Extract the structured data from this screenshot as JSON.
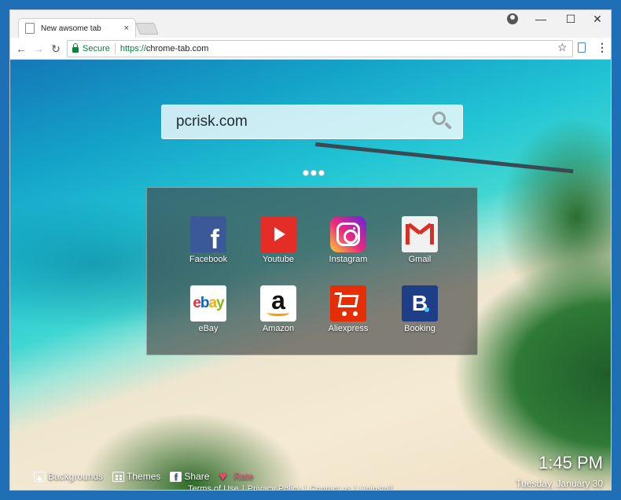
{
  "browser": {
    "tab_title": "New awsome tab",
    "tab_close": "×",
    "window_controls": {
      "minimize": "—",
      "maximize": "☐",
      "close": "✕"
    },
    "nav": {
      "back": "←",
      "forward": "→",
      "reload": "↻"
    },
    "address": {
      "secure_label": "Secure",
      "scheme": "https://",
      "host": "chrome-tab.com"
    },
    "star": "☆",
    "menu": "⋮"
  },
  "search": {
    "value": "pcrisk.com",
    "icon": "search-icon"
  },
  "tiles": [
    {
      "label": "Facebook",
      "icon": "facebook-icon"
    },
    {
      "label": "Youtube",
      "icon": "youtube-icon"
    },
    {
      "label": "Instagram",
      "icon": "instagram-icon"
    },
    {
      "label": "Gmail",
      "icon": "gmail-icon"
    },
    {
      "label": "eBay",
      "icon": "ebay-icon"
    },
    {
      "label": "Amazon",
      "icon": "amazon-icon"
    },
    {
      "label": "Aliexpress",
      "icon": "aliexpress-icon"
    },
    {
      "label": "Booking",
      "icon": "booking-icon"
    }
  ],
  "icon_glyphs": {
    "facebook": "f",
    "amazon": "a",
    "booking": "B"
  },
  "footer": {
    "links": [
      {
        "label": "Backgrounds",
        "icon": "image-icon"
      },
      {
        "label": "Themes",
        "icon": "themes-icon"
      },
      {
        "label": "Share",
        "icon": "facebook-icon"
      },
      {
        "label": "Rate",
        "icon": "heart-icon"
      }
    ],
    "legal": [
      "Terms of Use",
      "|",
      "Privacy Policy",
      "|",
      "Contact us",
      "|",
      "Uninstall"
    ]
  },
  "clock": {
    "time": "1:45 PM",
    "date": "Tuesday, January 30"
  },
  "colors": {
    "frame": "#1f6fb7",
    "secure_green": "#0b8043"
  }
}
